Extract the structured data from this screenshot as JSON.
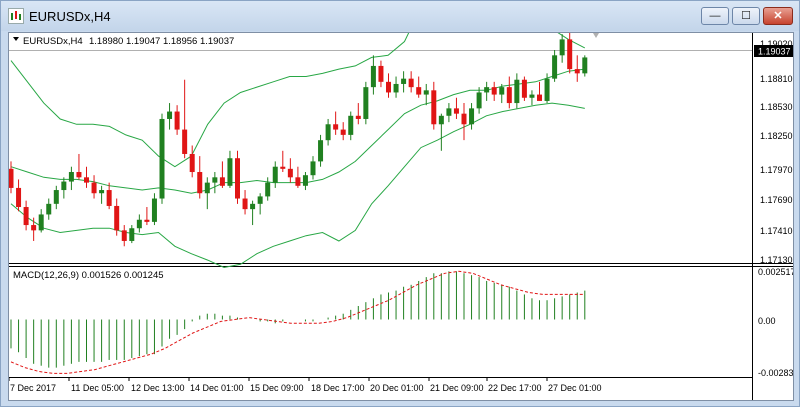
{
  "window": {
    "title": "EURUSDx,H4",
    "buttons": {
      "minimize": "—",
      "maximize": "☐",
      "close": "✕"
    }
  },
  "main_panel": {
    "header_symbol": "EURUSDx,H4",
    "header_ohlc": "1.18980 1.19047 1.18956 1.19037",
    "price_ticks": [
      "1.19020",
      "1.18810",
      "1.18530",
      "1.18250",
      "1.17970",
      "1.17690",
      "1.17410",
      "1.17130"
    ],
    "current_price": "1.19037"
  },
  "macd_panel": {
    "header": "MACD(12,26,9) 0.001526 0.001245",
    "ticks": [
      "0.002517",
      "0.00",
      "-0.00283"
    ]
  },
  "time_axis": [
    "7 Dec 2017",
    "11 Dec 05:00",
    "12 Dec 13:00",
    "14 Dec 01:00",
    "15 Dec 09:00",
    "18 Dec 17:00",
    "20 Dec 01:00",
    "21 Dec 09:00",
    "22 Dec 17:00",
    "27 Dec 01:00"
  ],
  "colors": {
    "bull": "#208020",
    "bear": "#e01515",
    "bands": "#28a745",
    "signal": "#e01515",
    "histogram": "#208020"
  },
  "chart_data": {
    "type": "candlestick",
    "candles": [
      [
        1.1798,
        1.1805,
        1.1775,
        1.178
      ],
      [
        1.178,
        1.1788,
        1.1758,
        1.1762
      ],
      [
        1.1762,
        1.1768,
        1.174,
        1.1745
      ],
      [
        1.1745,
        1.1752,
        1.173,
        1.174
      ],
      [
        1.174,
        1.176,
        1.1738,
        1.1755
      ],
      [
        1.1755,
        1.177,
        1.175,
        1.1765
      ],
      [
        1.1765,
        1.1782,
        1.176,
        1.1778
      ],
      [
        1.1778,
        1.179,
        1.177,
        1.1786
      ],
      [
        1.1786,
        1.18,
        1.1778,
        1.1795
      ],
      [
        1.1795,
        1.1812,
        1.1788,
        1.179
      ],
      [
        1.179,
        1.18,
        1.178,
        1.1785
      ],
      [
        1.1785,
        1.1792,
        1.177,
        1.1775
      ],
      [
        1.1775,
        1.1782,
        1.1765,
        1.1778
      ],
      [
        1.1778,
        1.1785,
        1.176,
        1.1763
      ],
      [
        1.1763,
        1.177,
        1.1735,
        1.174
      ],
      [
        1.174,
        1.1745,
        1.1725,
        1.173
      ],
      [
        1.173,
        1.1745,
        1.1728,
        1.1742
      ],
      [
        1.1742,
        1.1755,
        1.1738,
        1.175
      ],
      [
        1.175,
        1.1762,
        1.1745,
        1.1748
      ],
      [
        1.1748,
        1.1775,
        1.1745,
        1.177
      ],
      [
        1.177,
        1.185,
        1.1765,
        1.1845
      ],
      [
        1.1845,
        1.186,
        1.1835,
        1.1852
      ],
      [
        1.1852,
        1.1858,
        1.183,
        1.1835
      ],
      [
        1.1835,
        1.1882,
        1.1808,
        1.1812
      ],
      [
        1.1812,
        1.182,
        1.179,
        1.1795
      ],
      [
        1.1795,
        1.181,
        1.177,
        1.1775
      ],
      [
        1.1775,
        1.179,
        1.176,
        1.1785
      ],
      [
        1.1785,
        1.1795,
        1.1775,
        1.179
      ],
      [
        1.179,
        1.1805,
        1.178,
        1.1782
      ],
      [
        1.1782,
        1.1815,
        1.178,
        1.1808
      ],
      [
        1.1808,
        1.1815,
        1.1765,
        1.177
      ],
      [
        1.177,
        1.1778,
        1.1755,
        1.176
      ],
      [
        1.176,
        1.1768,
        1.1745,
        1.1765
      ],
      [
        1.1765,
        1.1775,
        1.1755,
        1.1772
      ],
      [
        1.1772,
        1.179,
        1.1768,
        1.1785
      ],
      [
        1.1785,
        1.1805,
        1.178,
        1.18
      ],
      [
        1.18,
        1.1815,
        1.1795,
        1.1798
      ],
      [
        1.1798,
        1.1808,
        1.1785,
        1.179
      ],
      [
        1.179,
        1.18,
        1.178,
        1.1782
      ],
      [
        1.1782,
        1.1795,
        1.1778,
        1.1792
      ],
      [
        1.1792,
        1.181,
        1.1788,
        1.1805
      ],
      [
        1.1805,
        1.183,
        1.18,
        1.1825
      ],
      [
        1.1825,
        1.1845,
        1.182,
        1.184
      ],
      [
        1.184,
        1.1852,
        1.183,
        1.1835
      ],
      [
        1.1835,
        1.1842,
        1.1825,
        1.183
      ],
      [
        1.183,
        1.1852,
        1.1825,
        1.1848
      ],
      [
        1.1848,
        1.186,
        1.184,
        1.1845
      ],
      [
        1.1845,
        1.188,
        1.184,
        1.1875
      ],
      [
        1.1875,
        1.1905,
        1.1868,
        1.1895
      ],
      [
        1.1895,
        1.19,
        1.1875,
        1.188
      ],
      [
        1.188,
        1.1888,
        1.1865,
        1.187
      ],
      [
        1.187,
        1.1885,
        1.1865,
        1.1878
      ],
      [
        1.1878,
        1.189,
        1.187,
        1.1883
      ],
      [
        1.1883,
        1.189,
        1.187,
        1.1875
      ],
      [
        1.1875,
        1.1885,
        1.1865,
        1.1868
      ],
      [
        1.1868,
        1.1878,
        1.1858,
        1.1872
      ],
      [
        1.1872,
        1.188,
        1.1835,
        1.184
      ],
      [
        1.184,
        1.185,
        1.1815,
        1.1848
      ],
      [
        1.1848,
        1.186,
        1.1842,
        1.1855
      ],
      [
        1.1855,
        1.1865,
        1.1845,
        1.185
      ],
      [
        1.185,
        1.186,
        1.1825,
        1.184
      ],
      [
        1.184,
        1.186,
        1.1835,
        1.1855
      ],
      [
        1.1855,
        1.1875,
        1.185,
        1.187
      ],
      [
        1.187,
        1.188,
        1.1862,
        1.1875
      ],
      [
        1.1875,
        1.188,
        1.1862,
        1.1868
      ],
      [
        1.1868,
        1.1878,
        1.186,
        1.1875
      ],
      [
        1.1875,
        1.1885,
        1.1855,
        1.186
      ],
      [
        1.186,
        1.1888,
        1.1855,
        1.1882
      ],
      [
        1.1882,
        1.1885,
        1.1862,
        1.1865
      ],
      [
        1.1865,
        1.1872,
        1.1858,
        1.1868
      ],
      [
        1.1868,
        1.188,
        1.1862,
        1.1862
      ],
      [
        1.1862,
        1.1888,
        1.186,
        1.1883
      ],
      [
        1.1883,
        1.191,
        1.188,
        1.1905
      ],
      [
        1.1905,
        1.1925,
        1.1898,
        1.192
      ],
      [
        1.192,
        1.1928,
        1.1888,
        1.1892
      ],
      [
        1.1892,
        1.1905,
        1.188,
        1.1888
      ],
      [
        1.1888,
        1.1905,
        1.1885,
        1.1903
      ]
    ],
    "bands_upper": [
      1.19,
      1.188,
      1.186,
      1.1845,
      1.184,
      1.184,
      1.1838,
      1.183,
      1.1825,
      1.181,
      1.18,
      1.181,
      1.184,
      1.186,
      1.187,
      1.1875,
      1.188,
      1.1885,
      1.1885,
      1.1888,
      1.1892,
      1.1895,
      1.1903,
      1.1905,
      1.1918,
      1.195,
      1.1968,
      1.1965,
      1.1958,
      1.195,
      1.1945,
      1.1942,
      1.1932,
      1.193,
      1.192,
      1.1912
    ],
    "bands_middle": [
      1.18,
      1.1795,
      1.179,
      1.1788,
      1.1788,
      1.1786,
      1.1782,
      1.178,
      1.1778,
      1.178,
      1.1778,
      1.1775,
      1.1778,
      1.1785,
      1.1785,
      1.1787,
      1.1785,
      1.1785,
      1.1785,
      1.1788,
      1.1795,
      1.1805,
      1.182,
      1.1835,
      1.185,
      1.1858,
      1.1862,
      1.1868,
      1.1872,
      1.1872,
      1.1876,
      1.1878,
      1.188,
      1.1885,
      1.189,
      1.1892
    ],
    "bands_lower": [
      1.1765,
      1.1752,
      1.1742,
      1.1738,
      1.174,
      1.1742,
      1.1742,
      1.1738,
      1.1736,
      1.1738,
      1.1725,
      1.1718,
      1.1712,
      1.1705,
      1.1708,
      1.1718,
      1.1725,
      1.173,
      1.1735,
      1.1738,
      1.173,
      1.174,
      1.1765,
      1.1782,
      1.18,
      1.1818,
      1.1825,
      1.1833,
      1.184,
      1.1848,
      1.1852,
      1.1855,
      1.1858,
      1.186,
      1.1858,
      1.1855
    ],
    "macd_histogram": [
      -0.0015,
      -0.0017,
      -0.002,
      -0.0023,
      -0.0024,
      -0.0025,
      -0.0025,
      -0.0024,
      -0.0023,
      -0.0022,
      -0.0022,
      -0.0022,
      -0.0022,
      -0.0021,
      -0.0021,
      -0.0021,
      -0.002,
      -0.0019,
      -0.0018,
      -0.0018,
      -0.0014,
      -0.001,
      -0.0008,
      -0.0005,
      -0.0001,
      0.0002,
      0.0003,
      0.0003,
      0.0002,
      0.0002,
      0.0001,
      0.0,
      0.0,
      -0.0001,
      -0.0001,
      -0.0002,
      -0.0001,
      0.0,
      0.0,
      -0.0001,
      -0.0001,
      0.0,
      0.0001,
      0.0002,
      0.0003,
      0.0005,
      0.0007,
      0.0009,
      0.0011,
      0.0013,
      0.0014,
      0.0015,
      0.0017,
      0.0018,
      0.002,
      0.0022,
      0.0024,
      0.0024,
      0.0025,
      0.0025,
      0.0024,
      0.0023,
      0.0022,
      0.002,
      0.0019,
      0.0018,
      0.0017,
      0.0015,
      0.0013,
      0.0011,
      0.001,
      0.001,
      0.0011,
      0.0012,
      0.0013,
      0.0014,
      0.0015
    ],
    "macd_signal": [
      -0.0022,
      -0.0025,
      -0.0027,
      -0.0028,
      -0.0028,
      -0.0027,
      -0.0026,
      -0.0024,
      -0.0022,
      -0.002,
      -0.0018,
      -0.0015,
      -0.0011,
      -0.0007,
      -0.0004,
      -0.0001,
      0.0,
      0.0001,
      0.0,
      -0.0001,
      -0.0002,
      -0.0002,
      -0.0002,
      -0.0001,
      0.0001,
      0.0004,
      0.0007,
      0.001,
      0.0014,
      0.0018,
      0.0021,
      0.0024,
      0.0025,
      0.0024,
      0.0021,
      0.0018,
      0.0016,
      0.0014,
      0.0013,
      0.0013,
      0.0013,
      0.0013
    ],
    "price_range": [
      1.1713,
      1.19185
    ],
    "macd_range": [
      -0.00283,
      0.002517
    ]
  }
}
